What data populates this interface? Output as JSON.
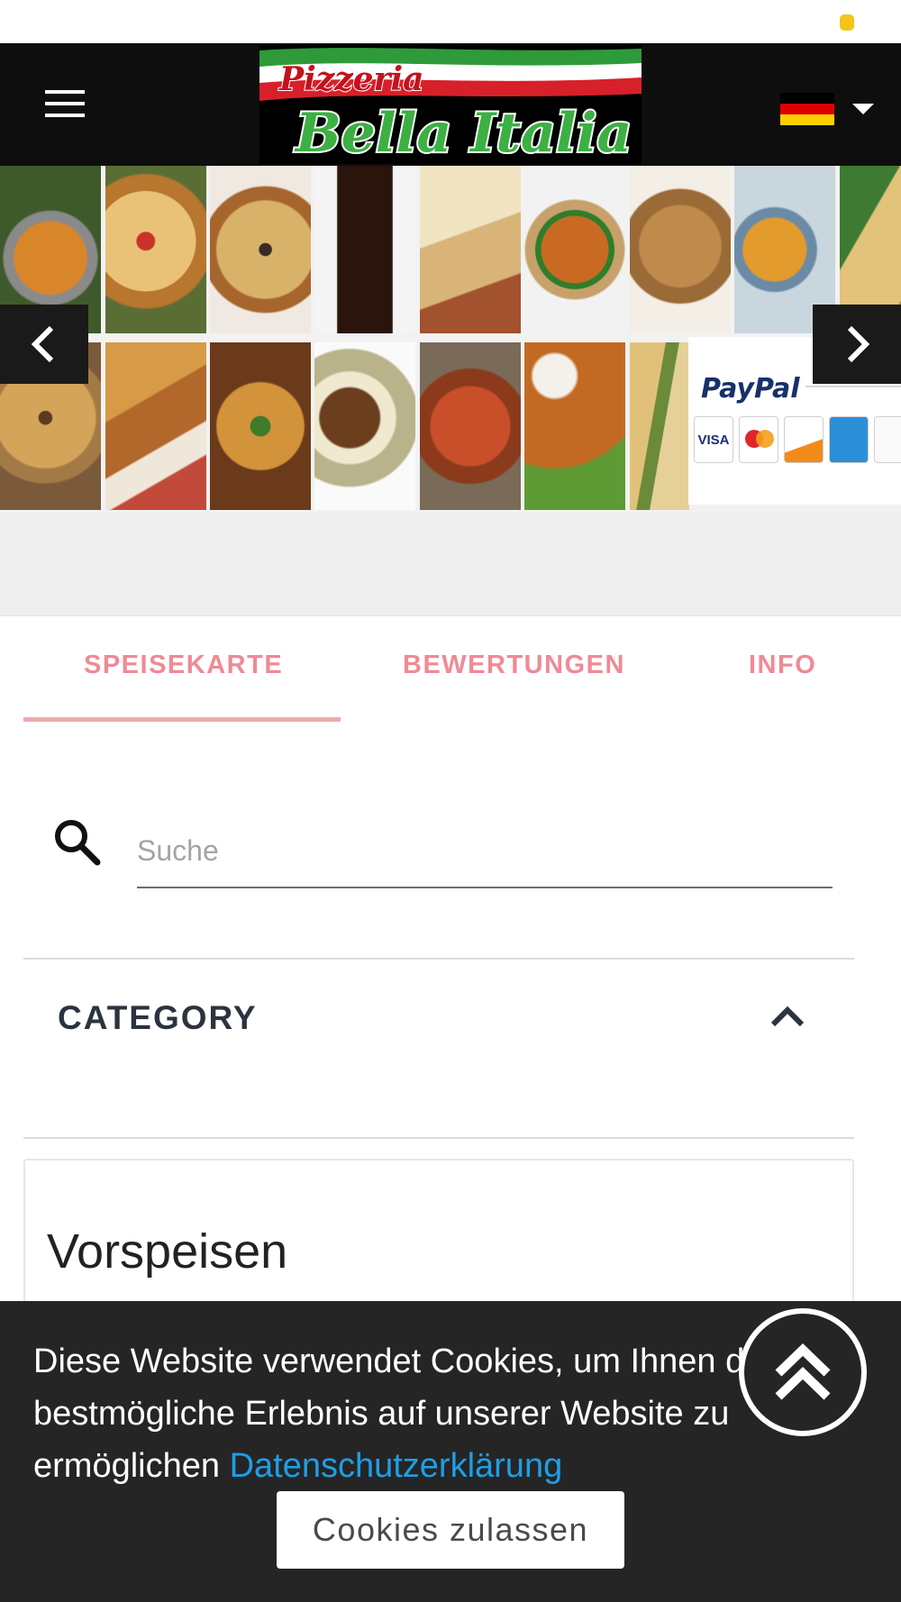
{
  "header": {
    "logo_line1": "Pizzeria",
    "logo_line2": "Bella Italia",
    "menu_icon": "hamburger-icon",
    "language_flag": "germany-flag",
    "colors": {
      "background": "#0e0e0e",
      "flag_black": "#000000",
      "flag_red": "#dd0000",
      "flag_gold": "#ffce00"
    }
  },
  "carousel": {
    "paypal_label": "PayPal",
    "card_brands": [
      "VISA",
      "MasterCard",
      "DISCOVER",
      "AMEX",
      "Diners Club"
    ],
    "prev_icon": "chevron-left-icon",
    "next_icon": "chevron-right-icon"
  },
  "tabs": [
    {
      "label": "SPEISEKARTE",
      "active": true
    },
    {
      "label": "BEWERTUNGEN",
      "active": false
    },
    {
      "label": "INFO",
      "active": false
    }
  ],
  "search": {
    "placeholder": "Suche",
    "value": ""
  },
  "category": {
    "title": "CATEGORY",
    "expanded": true
  },
  "section": {
    "title": "Vorspeisen"
  },
  "cookie": {
    "text": "Diese Website verwendet Cookies, um Ihnen das bestmögliche Erlebnis auf unserer Website zu ermöglichen",
    "link_label": "Datenschutzerklärung",
    "button_label": "Cookies zulassen"
  },
  "colors": {
    "accent_tab": "#ef8a96",
    "link": "#1e9fe6",
    "banner": "#252525"
  }
}
